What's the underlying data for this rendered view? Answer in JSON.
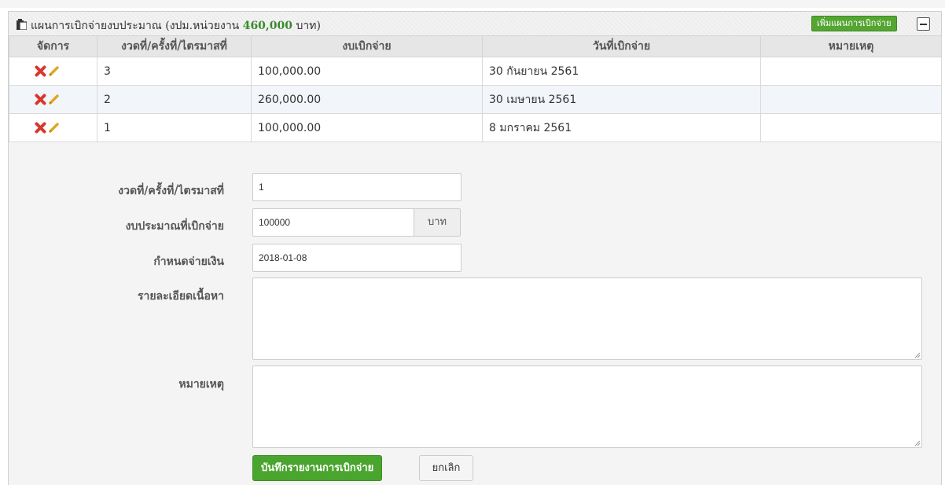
{
  "panel": {
    "title_text": "แผนการเบิกจ่ายงบประมาณ",
    "title_open": "(งปม.หน่วยงาน",
    "title_amount": "460,000",
    "title_unit": "บาท)",
    "add_button": "เพิ่มแผนการเบิกจ่าย",
    "icon": "clipboard-icon",
    "collapse_icon": "minus-icon"
  },
  "table": {
    "headers": [
      "จัดการ",
      "งวดที่/ครั้งที่/ไตรมาสที่",
      "งบเบิกจ่าย",
      "วันที่เบิกจ่าย",
      "หมายเหตุ"
    ],
    "rows": [
      {
        "period": "3",
        "amount": "100,000.00",
        "date": "30 กันยายน 2561",
        "note": ""
      },
      {
        "period": "2",
        "amount": "260,000.00",
        "date": "30 เมษายน 2561",
        "note": ""
      },
      {
        "period": "1",
        "amount": "100,000.00",
        "date": "8 มกราคม 2561",
        "note": ""
      }
    ],
    "delete_icon": "delete-x-icon",
    "edit_icon": "pencil-edit-icon"
  },
  "form": {
    "period_label": "งวดที่/ครั้งที่/ไตรมาสที่",
    "period_value": "1",
    "budget_label": "งบประมาณที่เบิกจ่าย",
    "budget_value": "100000",
    "budget_unit": "บาท",
    "due_label": "กำหนดจ่ายเงิน",
    "due_value": "2018-01-08",
    "detail_label": "รายละเอียดเนื้อหา",
    "detail_value": "",
    "note_label": "หมายเหตุ",
    "note_value": "",
    "save_button": "บันทึกรายงานการเบิกจ่าย",
    "cancel_button": "ยกเลิก"
  },
  "colors": {
    "accent_green": "#4aa52e",
    "amount_green": "#3a8a2e",
    "delete_red": "#d9372b",
    "edit_yellow": "#e0a820"
  }
}
